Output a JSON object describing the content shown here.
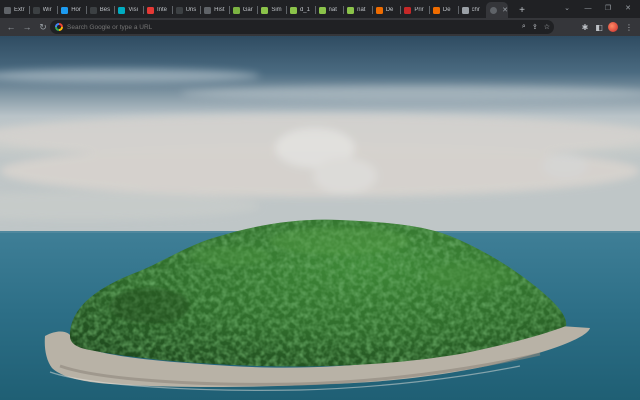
{
  "tabs": [
    {
      "title": "Extr",
      "icon": "puzzle-icon",
      "color": "#5f6368"
    },
    {
      "title": "Wir",
      "icon": "wordmark-w-icon",
      "color": "#3c4043"
    },
    {
      "title": "Hor",
      "icon": "twitter-bird-icon",
      "color": "#1d9bf0"
    },
    {
      "title": "Bes",
      "icon": "dark-square-icon",
      "color": "#3c4043"
    },
    {
      "title": "Visi",
      "icon": "arrow-leaf-icon",
      "color": "#00acc1"
    },
    {
      "title": "Inte",
      "icon": "red-chevron-icon",
      "color": "#e53935"
    },
    {
      "title": "Uns",
      "icon": "dark-square-icon",
      "color": "#3c4043"
    },
    {
      "title": "Hist",
      "icon": "history-clock-icon",
      "color": "#5f6368"
    },
    {
      "title": "Gar",
      "icon": "checker-icon",
      "color": "#7cb342"
    },
    {
      "title": "Sim",
      "icon": "green-tag-icon",
      "color": "#8bc34a"
    },
    {
      "title": "d_1",
      "icon": "green-tag-icon",
      "color": "#8bc34a"
    },
    {
      "title": "nat",
      "icon": "green-tag-icon",
      "color": "#8bc34a"
    },
    {
      "title": "nat",
      "icon": "green-tag-icon",
      "color": "#8bc34a"
    },
    {
      "title": "De",
      "icon": "image-doc-icon",
      "color": "#ef6c00"
    },
    {
      "title": "Prir",
      "icon": "image-doc-icon",
      "color": "#c62828"
    },
    {
      "title": "De",
      "icon": "image-doc-icon",
      "color": "#ef6c00"
    },
    {
      "title": "chr",
      "icon": "chrome-icon",
      "color": "#9aa0a6"
    }
  ],
  "active_tab": {
    "icon": "chrome-icon",
    "close_glyph": "✕"
  },
  "new_tab_glyph": "+",
  "window_controls": {
    "dropdown": "⌄",
    "minimize": "—",
    "restore": "❐",
    "close": "✕"
  },
  "toolbar": {
    "back_glyph": "←",
    "forward_glyph": "→",
    "reload_glyph": "↻",
    "omnibox_placeholder": "Search Google or type a URL",
    "zoom_glyph": "⌕",
    "share_glyph": "⇪",
    "bookmark_glyph": "☆",
    "extensions_glyph": "✱",
    "side_panel_glyph": "◧",
    "menu_glyph": "⋮"
  },
  "colors": {
    "frame": "#202124",
    "toolbar": "#35363a",
    "sky_top": "#2f4c62",
    "sea": "#2c6e86",
    "foliage": "#2f6b2b"
  }
}
